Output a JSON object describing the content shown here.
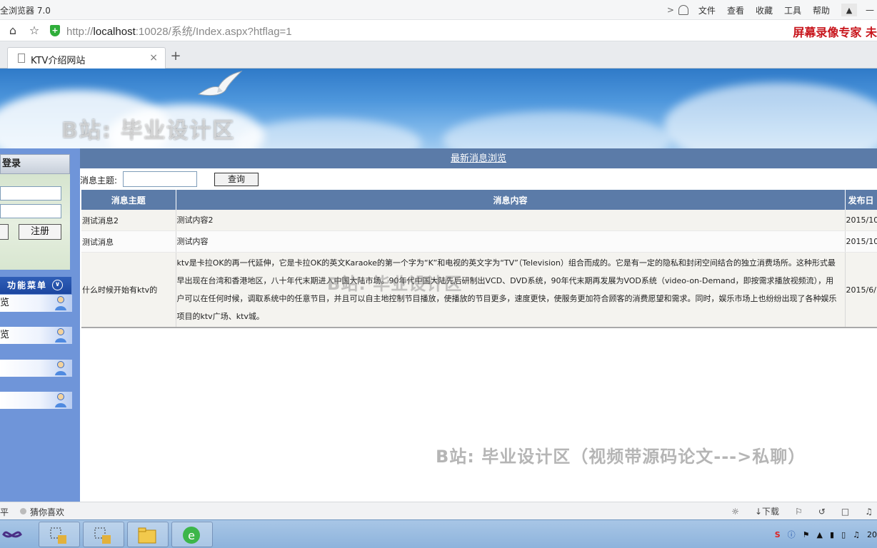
{
  "browser": {
    "title": "全浏览器 7.0",
    "menu": [
      "文件",
      "查看",
      "收藏",
      "工具",
      "帮助"
    ],
    "url_prefix": "http://",
    "url_host": "localhost",
    "url_rest": ":10028/系统/Index.aspx?htflag=1",
    "recorder_text": "屏幕录像专家  未",
    "tab_title": "KTV介绍网站",
    "new_tab": "+",
    "tab_close": "×",
    "minimize": "—"
  },
  "watermarks": {
    "banner": "B站: 毕业设计区",
    "mid": "B站: 毕业设计区",
    "bottom": "B站: 毕业设计区（视频带源码论文--->私聊）"
  },
  "sidebar": {
    "login_header": "登录",
    "register_label": "注册",
    "function_menu": "功能菜单",
    "items": [
      "览",
      "览",
      "",
      ""
    ]
  },
  "content": {
    "header_link": "最新消息浏览",
    "search_label": "消息主题:",
    "search_value": "",
    "search_button": "查询",
    "columns": [
      "消息主题",
      "消息内容",
      "发布日"
    ],
    "rows": [
      {
        "subject": "测试消息2",
        "content": "测试内容2",
        "date": "2015/10"
      },
      {
        "subject": "测试消息",
        "content": "测试内容",
        "date": "2015/10"
      },
      {
        "subject": "什么时候开始有ktv的",
        "content": "ktv是卡拉OK的再一代延伸，它是卡拉OK的英文Karaoke的第一个字为“K”和电视的英文字为“TV”（Television）组合而成的。它是有一定的隐私和封闭空间结合的独立消费场所。这种形式最早出现在台湾和香港地区，八十年代末期进入中国大陆市场。90年代中国大陆先后研制出VCD、DVD系统，90年代末期再发展为VOD系统（video-on-Demand，即按需求播放视频流），用户可以在任何时候，调取系统中的任意节目，并且可以自主地控制节目播放，使播放的节目更多，速度更快，使服务更加符合顾客的消费愿望和需求。同时，娱乐市场上也纷纷出现了各种娱乐项目的ktv广场、ktv城。",
        "date": "2015/6/"
      }
    ]
  },
  "statusbar": {
    "left": "平",
    "guess": "猜你喜欢",
    "download": "下载"
  },
  "taskbar": {
    "clock": "20"
  }
}
